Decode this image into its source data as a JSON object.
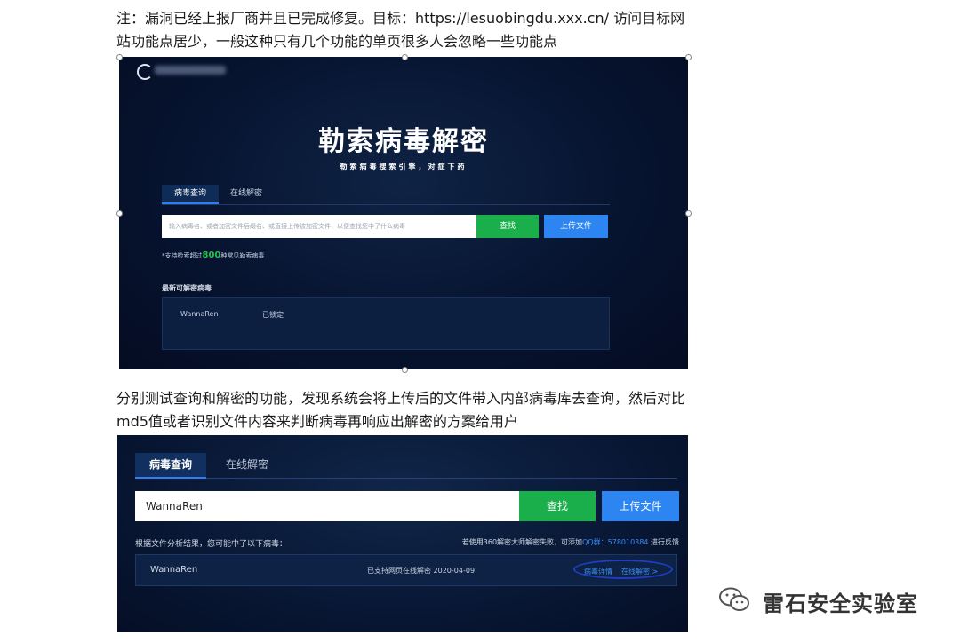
{
  "article": {
    "paragraph1": "注：漏洞已经上报厂商并且已完成修复。目标：https://lesuobingdu.xxx.cn/ 访问目标网站功能点居少，一般这种只有几个功能的单页很多人会忽略一些功能点",
    "paragraph2": "分别测试查询和解密的功能，发现系统会将上传后的文件带入内部病毒库去查询，然后对比md5值或者识别文件内容来判断病毒再响应出解密的方案给用户"
  },
  "screenshot1": {
    "title": "勒索病毒解密",
    "subtitle": "勒索病毒搜索引擎，对症下药",
    "tabs": [
      "病毒查询",
      "在线解密"
    ],
    "search_placeholder": "输入病毒名、或者加密文件后缀名、或直接上传被加密文件，以便查找您中了什么病毒",
    "find_button": "查找",
    "upload_button": "上传文件",
    "support_prefix": "*支持检索超过",
    "support_count": "800",
    "support_suffix": "种常见勒索病毒",
    "latest_label": "最新可解密病毒",
    "latest_name": "WannaRen",
    "latest_status": "已锁定"
  },
  "screenshot2": {
    "tabs": [
      "病毒查询",
      "在线解密"
    ],
    "search_value": "WannaRen",
    "find_button": "查找",
    "upload_button": "上传文件",
    "analysis_text": "根据文件分析结果，您可能中了以下病毒：",
    "feedback_prefix": "若使用360解密大师解密失败，可添加",
    "feedback_qq": "QQ群：578010384",
    "feedback_suffix": "进行反馈",
    "result_name": "WannaRen",
    "result_status": "已支持网页在线解密 2020-04-09",
    "link_detail": "病毒详情",
    "link_decrypt": "在线解密 >"
  },
  "watermark": {
    "text": "雷石安全实验室",
    "icon": "wechat-icon"
  }
}
